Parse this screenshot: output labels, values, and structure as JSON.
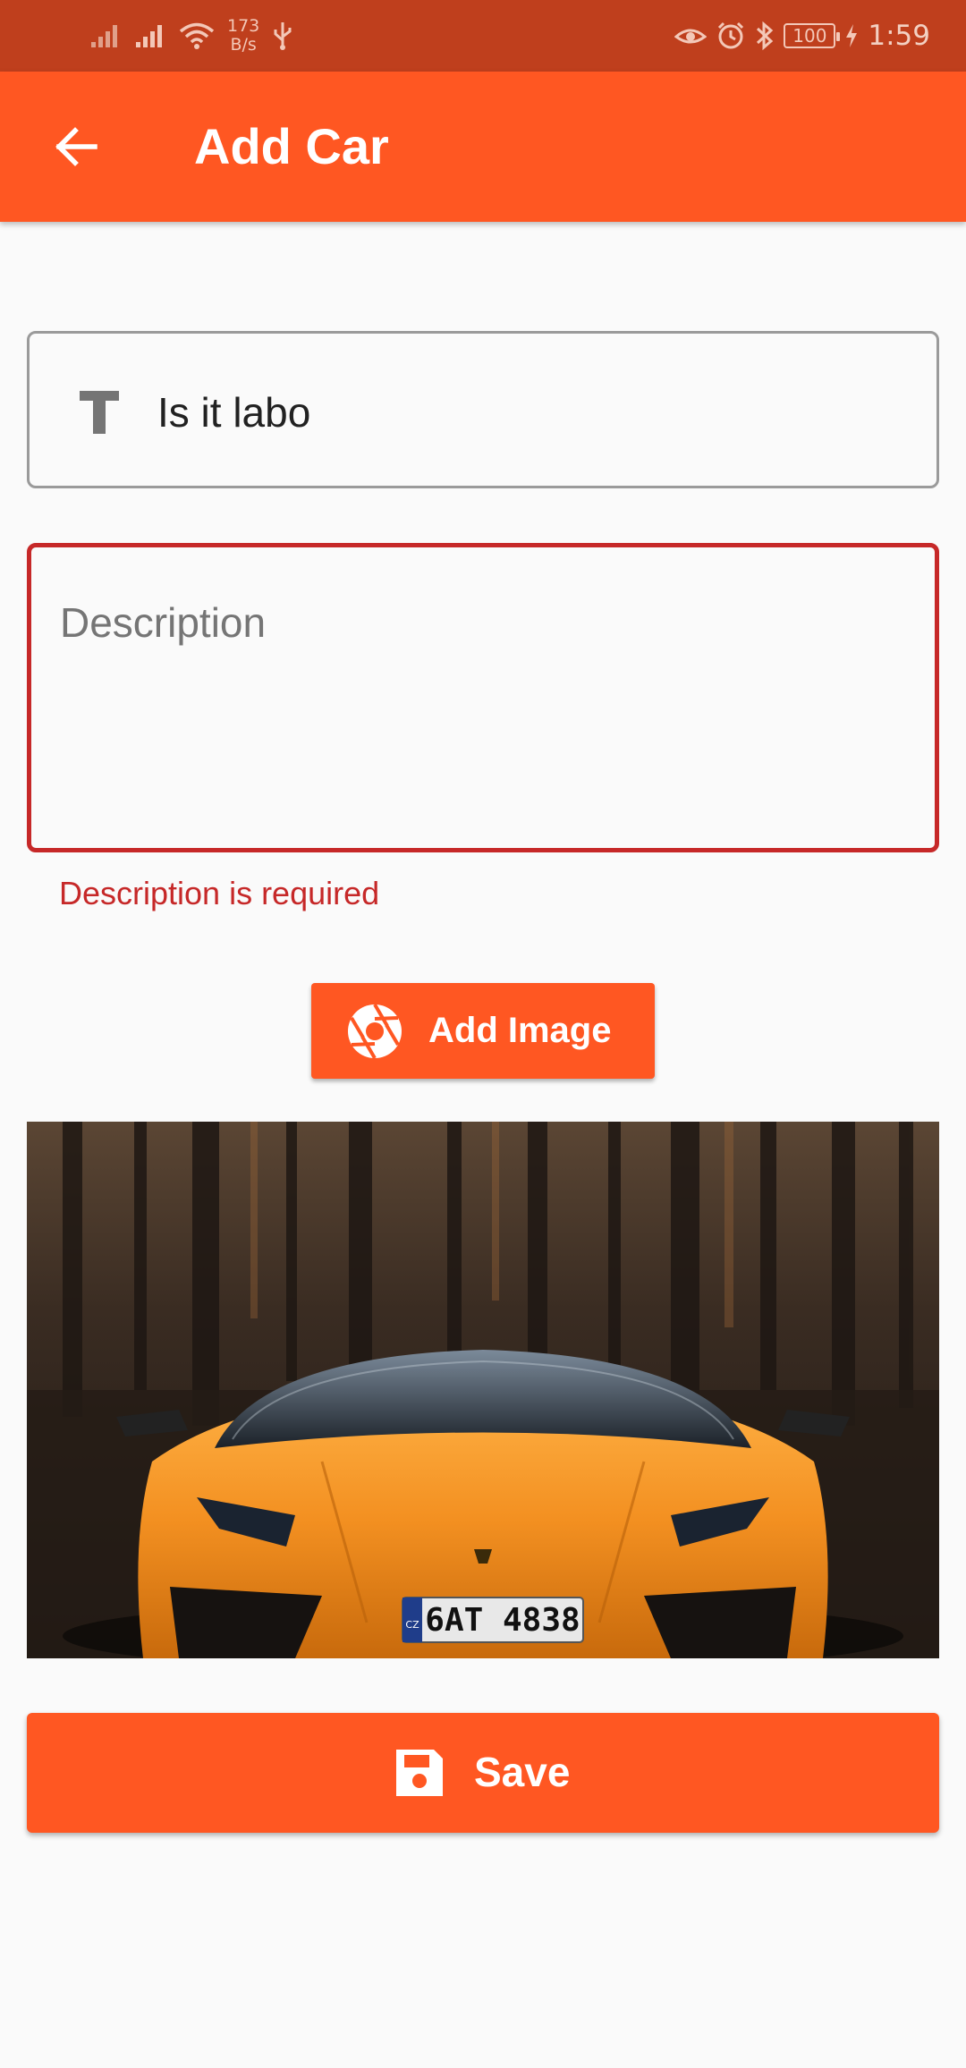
{
  "status_bar": {
    "speed_value": "173",
    "speed_unit": "B/s",
    "battery": "100",
    "time": "1:59"
  },
  "app_bar": {
    "title": "Add Car"
  },
  "form": {
    "title_value": "Is it labo",
    "description_placeholder": "Description",
    "description_error": "Description is required",
    "add_image_label": "Add Image",
    "plate_text": "6AT 4838",
    "plate_country": "CZ",
    "save_label": "Save"
  },
  "colors": {
    "primary": "#ff5722",
    "status_bar": "#bf3f1d",
    "error": "#c62828"
  },
  "icons": {
    "back": "arrow-left-icon",
    "title_field": "text-t-icon",
    "add_image": "camera-aperture-icon",
    "save": "floppy-disk-icon"
  }
}
